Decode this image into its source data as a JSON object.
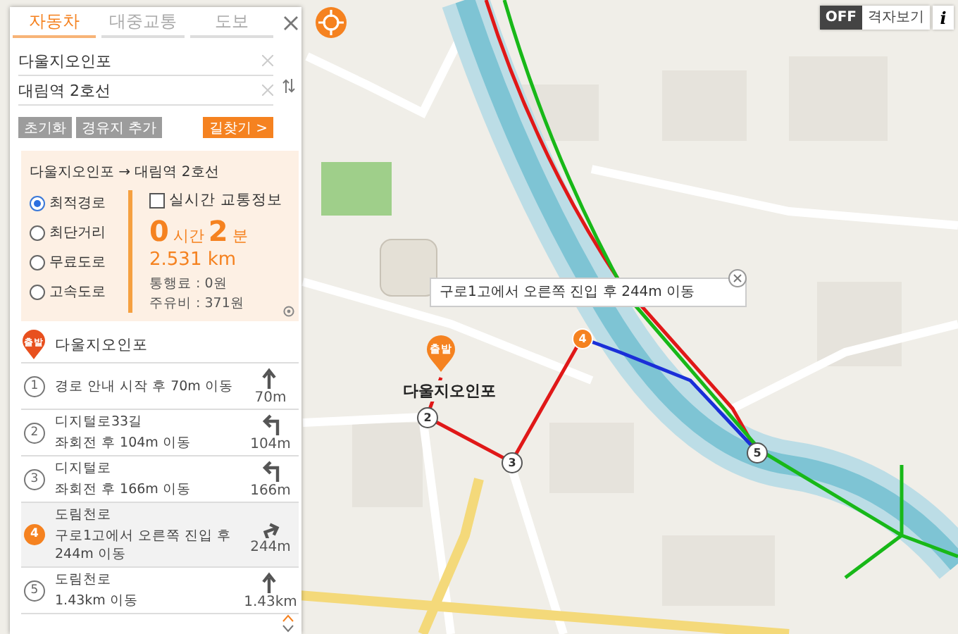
{
  "panel": {
    "tabs": [
      {
        "label": "자동차",
        "selected": true
      },
      {
        "label": "대중교통",
        "selected": false
      },
      {
        "label": "도보",
        "selected": false
      }
    ],
    "origin": {
      "value": "다울지오인포"
    },
    "destination": {
      "value": "대림역 2호선"
    },
    "buttons": {
      "reset": "초기화",
      "add_waypoint": "경유지 추가",
      "search": "길찾기 >"
    },
    "summary": {
      "title": "다울지오인포 → 대림역 2호선",
      "options": [
        {
          "label": "최적경로",
          "selected": true
        },
        {
          "label": "최단거리",
          "selected": false
        },
        {
          "label": "무료도로",
          "selected": false
        },
        {
          "label": "고속도로",
          "selected": false
        }
      ],
      "realtime": {
        "label": "실시간 교통정보",
        "checked": false
      },
      "hours": "0",
      "hours_unit": "시간",
      "minutes": "2",
      "minutes_unit": "분",
      "distance": "2.531 km",
      "toll": "통행료 : 0원",
      "fuel": "주유비 : 371원"
    },
    "start": {
      "badge": "출발",
      "name": "다울지오인포"
    },
    "steps": [
      {
        "number": "1",
        "title": "경로 안내 시작 후 70m 이동",
        "kind": "straight",
        "distance": "70m",
        "selected": false
      },
      {
        "number": "2",
        "title": "디지털로33길",
        "detail": "좌회전 후 104m 이동",
        "kind": "left",
        "distance": "104m",
        "selected": false
      },
      {
        "number": "3",
        "title": "디지털로",
        "detail": "좌회전 후 166m 이동",
        "kind": "left",
        "distance": "166m",
        "selected": false
      },
      {
        "number": "4",
        "title": "도림천로",
        "detail": "구로1고에서 오른쪽 진입 후 244m 이동",
        "kind": "right",
        "distance": "244m",
        "selected": true
      },
      {
        "number": "5",
        "title": "도림천로",
        "detail": "1.43km 이동",
        "kind": "straight",
        "distance": "1.43km",
        "selected": false
      }
    ]
  },
  "map": {
    "grid_toggle": {
      "state": "OFF",
      "label": "격자보기"
    },
    "info": "i",
    "start_marker": {
      "badge": "출발",
      "label": "다울지오인포"
    },
    "popup": {
      "text": "구로1고에서 오른쪽 진입 후 244m 이동"
    },
    "markers": [
      {
        "number": "2",
        "selected": false
      },
      {
        "number": "3",
        "selected": false
      },
      {
        "number": "4",
        "selected": true
      },
      {
        "number": "5",
        "selected": false
      }
    ]
  }
}
